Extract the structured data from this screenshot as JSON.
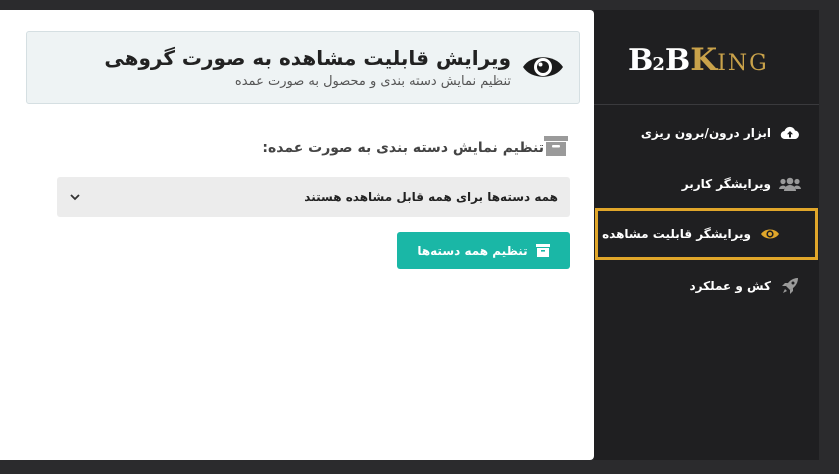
{
  "header": {
    "title": "ویرایش قابلیت مشاهده به صورت گروهی",
    "subtitle": "تنظیم نمایش دسته بندی و محصول به صورت عمده",
    "icon": "eye-icon"
  },
  "section": {
    "title": "تنظیم نمایش دسته بندی به صورت عمده:",
    "icon": "archive-box-icon"
  },
  "select": {
    "value": "همه دسته‌ها برای همه قابل مشاهده هستند"
  },
  "apply_button": {
    "label": "تنظیم همه دسته‌ها",
    "icon": "archive-box-icon"
  },
  "brand": {
    "part1": "B",
    "part2": "2",
    "part3": "B",
    "part4": "K",
    "part5": "ING"
  },
  "sidebar": {
    "items": [
      {
        "label": "ابزار درون/برون ریزی",
        "icon": "cloud-upload-icon",
        "active": false
      },
      {
        "label": "ویرایشگر کاربر",
        "icon": "users-icon",
        "active": false
      },
      {
        "label": "ویرایشگر قابلیت مشاهده",
        "icon": "eye-icon",
        "active": true
      },
      {
        "label": "کش و عملکرد",
        "icon": "rocket-icon",
        "active": false
      }
    ]
  },
  "colors": {
    "accent_teal": "#1ab7a6",
    "active_border": "#e0a62a",
    "brand_gold": "#c9a24a",
    "sidebar_bg": "#1f1f21"
  }
}
